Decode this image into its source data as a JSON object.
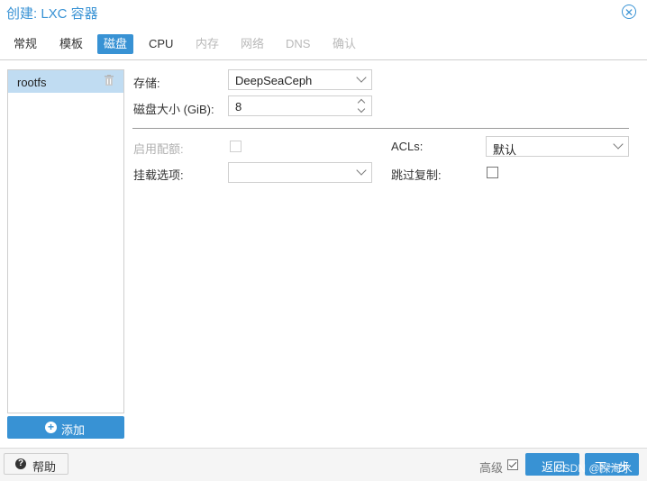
{
  "window": {
    "title": "创建: LXC 容器"
  },
  "tabs": [
    {
      "label": "常规",
      "state": "normal"
    },
    {
      "label": "模板",
      "state": "normal"
    },
    {
      "label": "磁盘",
      "state": "active"
    },
    {
      "label": "CPU",
      "state": "normal"
    },
    {
      "label": "内存",
      "state": "disabled"
    },
    {
      "label": "网络",
      "state": "disabled"
    },
    {
      "label": "DNS",
      "state": "disabled"
    },
    {
      "label": "确认",
      "state": "disabled"
    }
  ],
  "disk_list": {
    "items": [
      {
        "label": "rootfs",
        "selected": true
      }
    ],
    "add_label": "添加"
  },
  "form": {
    "storage": {
      "label": "存储:",
      "value": "DeepSeaCeph"
    },
    "disk_size": {
      "label": "磁盘大小 (GiB):",
      "value": "8"
    },
    "quota": {
      "label": "启用配额:",
      "checked": false,
      "disabled": true
    },
    "mount_options": {
      "label": "挂载选项:",
      "value": ""
    },
    "acls": {
      "label": "ACLs:",
      "value": "默认"
    },
    "skip_replication": {
      "label": "跳过复制:",
      "checked": false
    }
  },
  "footer": {
    "help_label": "帮助",
    "advanced_label": "高级",
    "advanced_checked": true,
    "back_label": "返回",
    "next_label": "下一步"
  },
  "watermark": "CSDN @探海水",
  "colors": {
    "accent": "#3892d4",
    "selected_row": "#c0dcf2"
  }
}
